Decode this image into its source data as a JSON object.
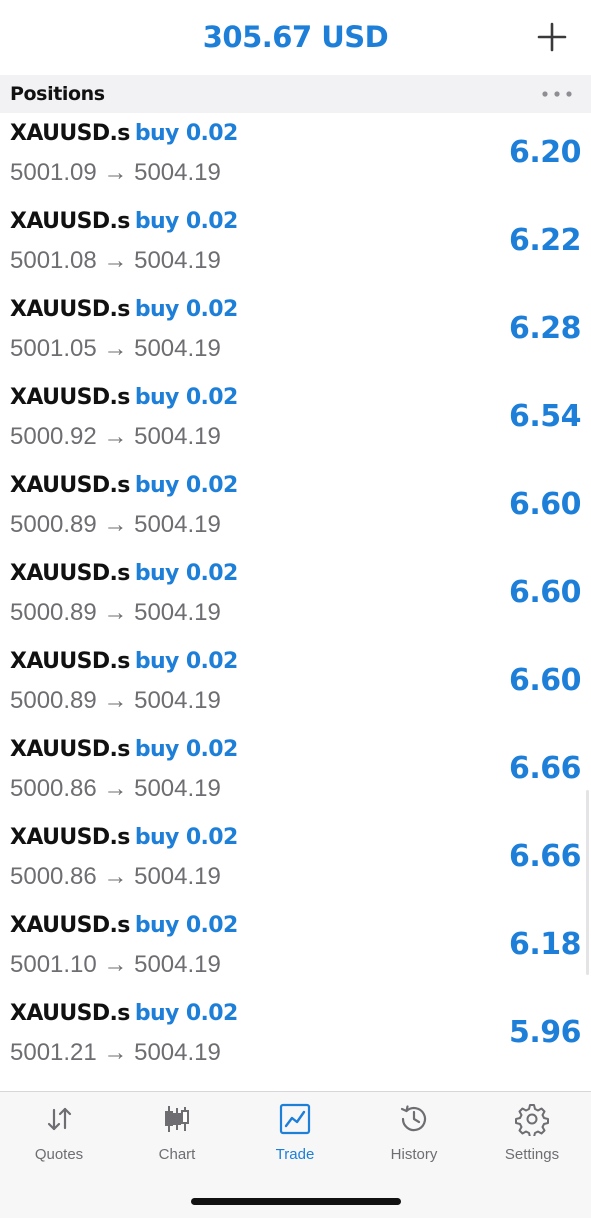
{
  "header": {
    "balance": "305.67 USD",
    "add_icon": "plus-icon"
  },
  "section": {
    "title": "Positions",
    "more_icon": "ellipsis-icon"
  },
  "positions": [
    {
      "symbol": "XAUUSD.s",
      "side": "buy 0.02",
      "prices": "5001.09 → 5004.19",
      "profit": "6.20"
    },
    {
      "symbol": "XAUUSD.s",
      "side": "buy 0.02",
      "prices": "5001.08 → 5004.19",
      "profit": "6.22"
    },
    {
      "symbol": "XAUUSD.s",
      "side": "buy 0.02",
      "prices": "5001.05 → 5004.19",
      "profit": "6.28"
    },
    {
      "symbol": "XAUUSD.s",
      "side": "buy 0.02",
      "prices": "5000.92 → 5004.19",
      "profit": "6.54"
    },
    {
      "symbol": "XAUUSD.s",
      "side": "buy 0.02",
      "prices": "5000.89 → 5004.19",
      "profit": "6.60"
    },
    {
      "symbol": "XAUUSD.s",
      "side": "buy 0.02",
      "prices": "5000.89 → 5004.19",
      "profit": "6.60"
    },
    {
      "symbol": "XAUUSD.s",
      "side": "buy 0.02",
      "prices": "5000.89 → 5004.19",
      "profit": "6.60"
    },
    {
      "symbol": "XAUUSD.s",
      "side": "buy 0.02",
      "prices": "5000.86 → 5004.19",
      "profit": "6.66"
    },
    {
      "symbol": "XAUUSD.s",
      "side": "buy 0.02",
      "prices": "5000.86 → 5004.19",
      "profit": "6.66"
    },
    {
      "symbol": "XAUUSD.s",
      "side": "buy 0.02",
      "prices": "5001.10 → 5004.19",
      "profit": "6.18"
    },
    {
      "symbol": "XAUUSD.s",
      "side": "buy 0.02",
      "prices": "5001.21 → 5004.19",
      "profit": "5.96"
    }
  ],
  "tabbar": {
    "tabs": [
      {
        "label": "Quotes",
        "icon": "sort-arrows-icon",
        "active": false
      },
      {
        "label": "Chart",
        "icon": "candlestick-icon",
        "active": false
      },
      {
        "label": "Trade",
        "icon": "trend-chart-icon",
        "active": true
      },
      {
        "label": "History",
        "icon": "clock-history-icon",
        "active": false
      },
      {
        "label": "Settings",
        "icon": "gear-icon",
        "active": false
      }
    ]
  },
  "colors": {
    "accent": "#1e7fd8",
    "text": "#111111",
    "secondary_text": "#6e6e72",
    "section_background": "#f2f2f4",
    "tabbar_background": "#f7f7f8"
  }
}
